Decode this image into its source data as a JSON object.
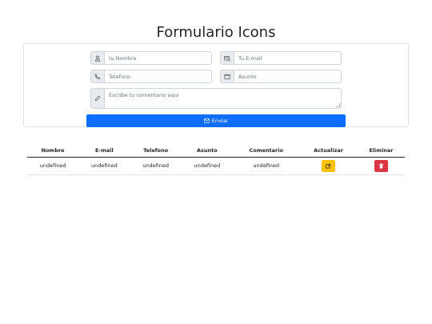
{
  "page": {
    "title": "Formulario Icons"
  },
  "form": {
    "name_placeholder": "tu Nombre",
    "email_placeholder": "Tu E-mail",
    "phone_placeholder": "Telefono",
    "subject_placeholder": "Asunto",
    "comment_placeholder": "Escribe tu comentario aqui",
    "submit_label": "Enviar"
  },
  "table": {
    "headers": [
      "Nombre",
      "E-mail",
      "Telefono",
      "Asunto",
      "Comentario",
      "Actualizar",
      "Eliminar"
    ],
    "rows": [
      [
        "undefined",
        "undefined",
        "undefined",
        "undefined",
        "undefined"
      ]
    ]
  },
  "colors": {
    "primary": "#0d6efd",
    "warning": "#ffc107",
    "danger": "#dc3545"
  },
  "icons": {
    "name": "person-icon",
    "email": "envelope-at-icon",
    "phone": "telephone-icon",
    "subject": "calendar-icon",
    "comment": "pencil-icon",
    "submit": "envelope-icon",
    "update": "pencil-square-icon",
    "delete": "trash-icon"
  }
}
